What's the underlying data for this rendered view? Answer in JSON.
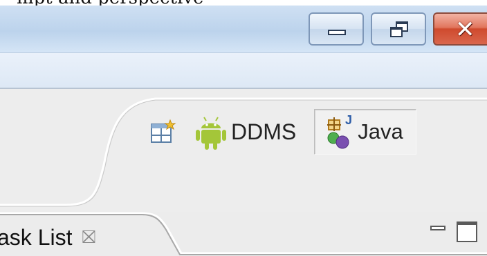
{
  "caption": {
    "text": "mpt and perspective"
  },
  "window": {
    "minimize_label": "Minimize",
    "restore_label": "Restore",
    "close_glyph": "✕"
  },
  "perspectives": {
    "open_perspective_icon": "open-perspective-icon",
    "items": [
      {
        "label": "DDMS",
        "icon": "android-icon",
        "active": false
      },
      {
        "label": "Java",
        "icon": "java-perspective-icon",
        "active": true
      }
    ]
  },
  "view": {
    "tab_label": "ask List",
    "tab_close_glyph": "⛝",
    "minimize_icon": "minimize-view-icon",
    "maximize_icon": "maximize-view-icon"
  },
  "colors": {
    "android_green": "#a4c639",
    "close_red": "#d9664c"
  }
}
